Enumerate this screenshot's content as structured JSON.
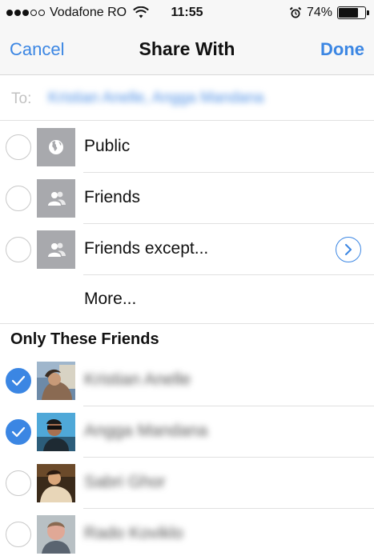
{
  "status_bar": {
    "carrier": "Vodafone RO",
    "time": "11:55",
    "battery": "74%",
    "battery_level": 0.74,
    "icons": [
      "signal-dots",
      "wifi-icon",
      "alarm-icon",
      "battery-icon"
    ]
  },
  "nav": {
    "cancel": "Cancel",
    "title": "Share With",
    "done": "Done"
  },
  "to_field": {
    "label": "To:",
    "recipients": "Kristian Anelle, Angga Mandana"
  },
  "options": [
    {
      "label": "Public",
      "icon": "globe-icon",
      "selected": false
    },
    {
      "label": "Friends",
      "icon": "friends-icon",
      "selected": false
    },
    {
      "label": "Friends except...",
      "icon": "friends-icon",
      "selected": false,
      "accessory": "chevron-right-circle-icon"
    }
  ],
  "more": {
    "label": "More..."
  },
  "section": {
    "title": "Only These Friends"
  },
  "friends": [
    {
      "name": "Kristian Anelle",
      "selected": true
    },
    {
      "name": "Angga Mandana",
      "selected": true
    },
    {
      "name": "Sabri Ghor",
      "selected": false
    },
    {
      "name": "Rado Koviklo",
      "selected": false
    }
  ],
  "colors": {
    "accent": "#3b86e3",
    "icon_bg": "#a8a9ad",
    "separator": "#e0e0e0"
  }
}
